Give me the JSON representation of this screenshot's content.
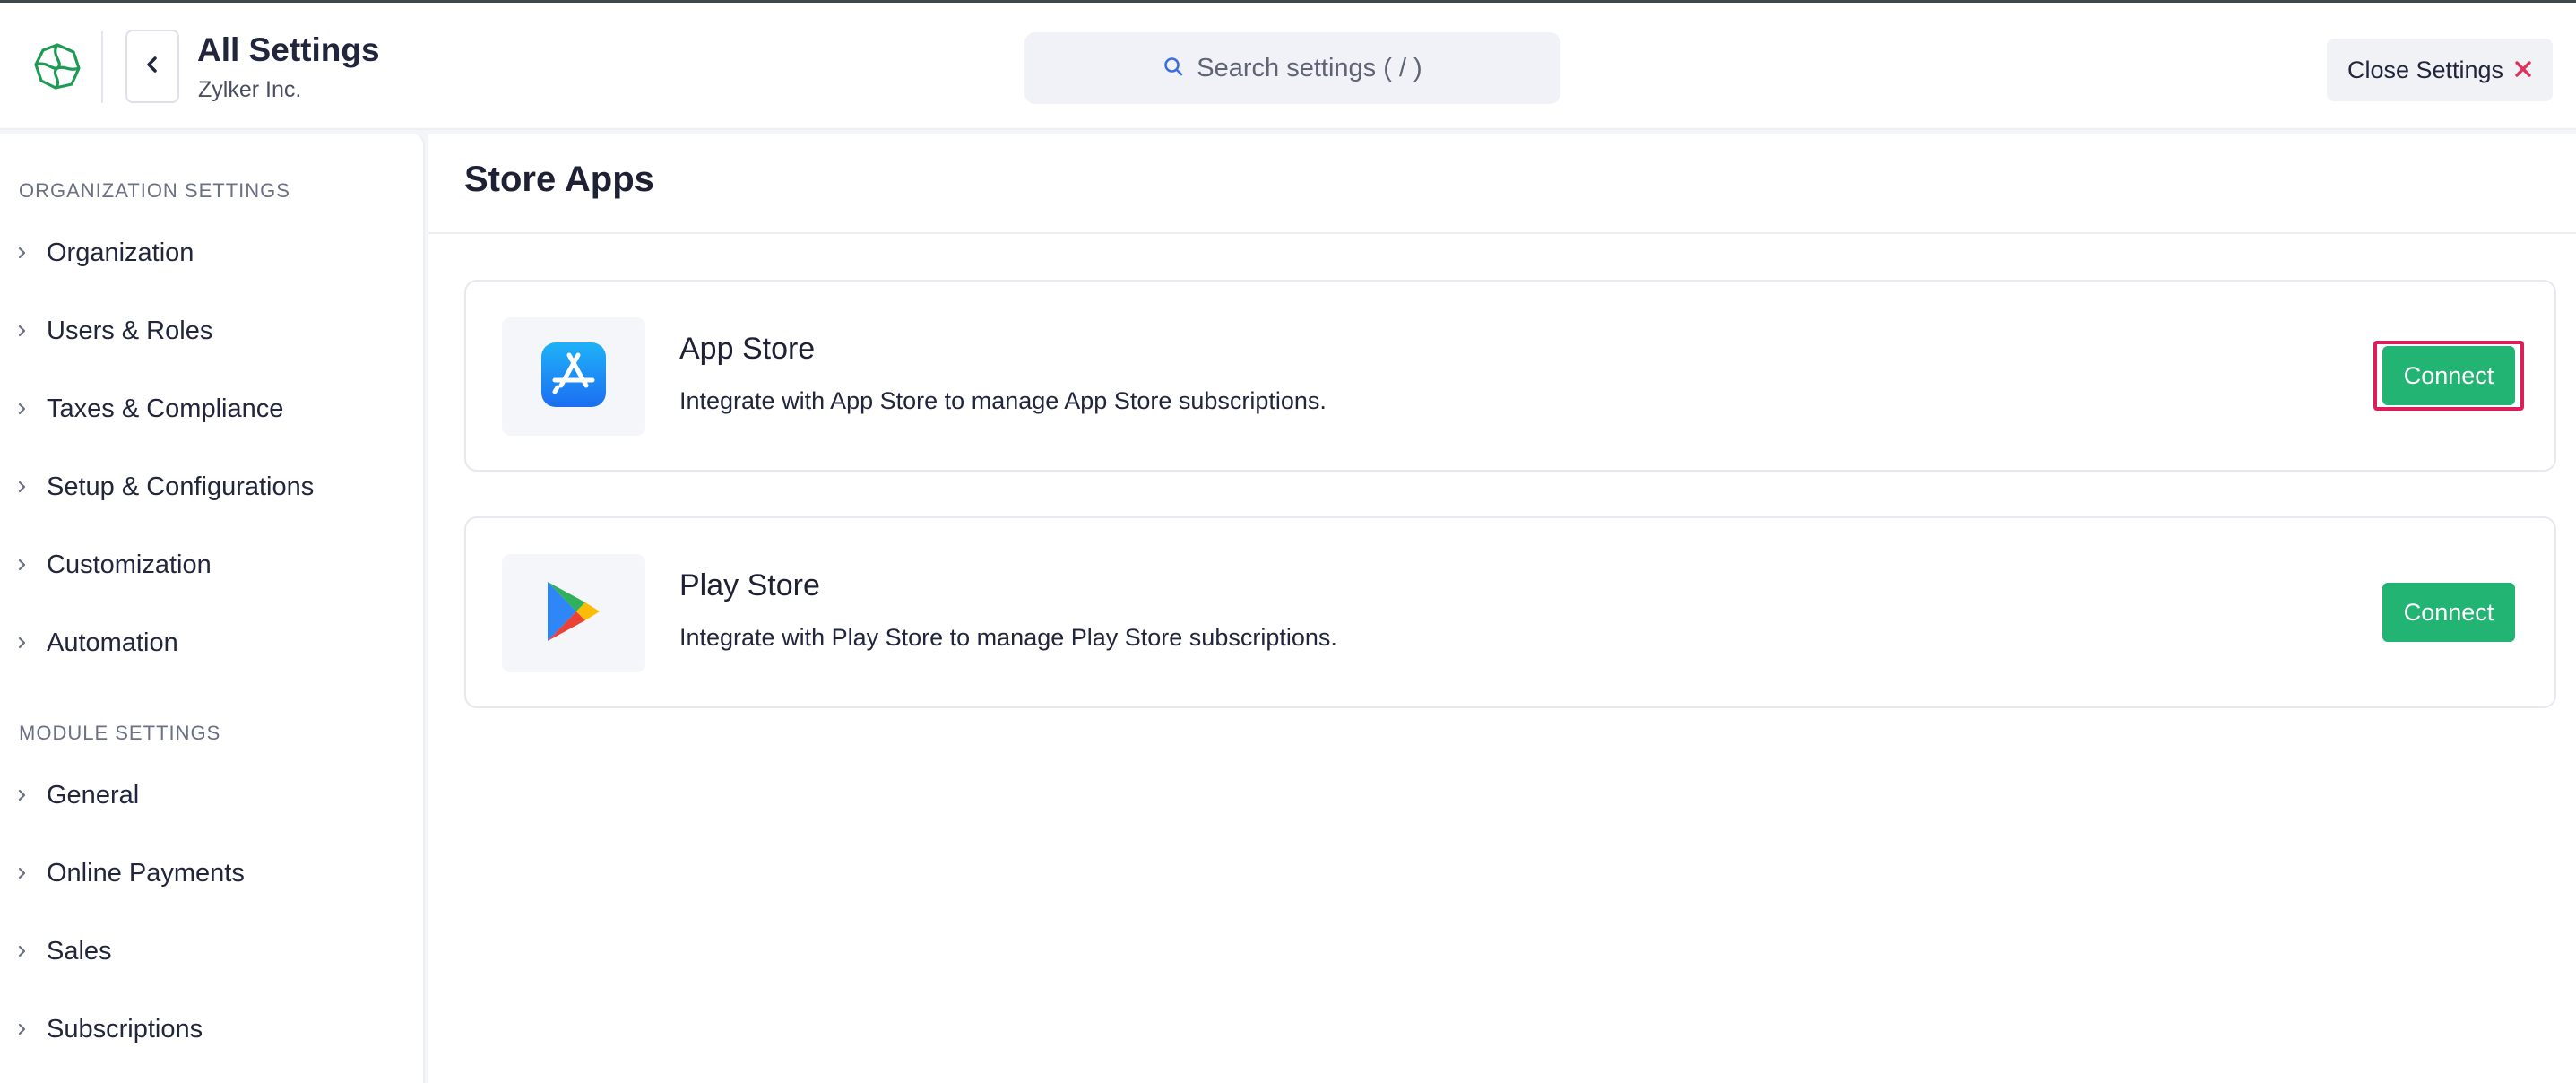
{
  "header": {
    "title": "All Settings",
    "organization": "Zylker Inc.",
    "logo_icon": "zoho-billing-logo-icon",
    "back_icon": "chevron-left-icon",
    "search": {
      "placeholder": "Search settings ( / )",
      "icon": "search-icon"
    },
    "close_label": "Close Settings",
    "close_icon": "close-icon"
  },
  "sidebar": {
    "org_section_title": "ORGANIZATION SETTINGS",
    "org_items": [
      {
        "label": "Organization"
      },
      {
        "label": "Users & Roles"
      },
      {
        "label": "Taxes & Compliance"
      },
      {
        "label": "Setup & Configurations"
      },
      {
        "label": "Customization"
      },
      {
        "label": "Automation"
      }
    ],
    "module_section_title": "MODULE SETTINGS",
    "module_items": [
      {
        "label": "General"
      },
      {
        "label": "Online Payments"
      },
      {
        "label": "Sales"
      },
      {
        "label": "Subscriptions"
      }
    ]
  },
  "main": {
    "title": "Store Apps",
    "apps": [
      {
        "name": "App Store",
        "description": "Integrate with App Store to manage App Store subscriptions.",
        "button_label": "Connect",
        "icon": "app-store-icon",
        "highlighted": true
      },
      {
        "name": "Play Store",
        "description": "Integrate with Play Store to manage Play Store subscriptions.",
        "button_label": "Connect",
        "icon": "play-store-icon",
        "highlighted": false
      }
    ]
  },
  "colors": {
    "accent_green": "#22b473",
    "highlight_red": "#dd1e58",
    "close_x_red": "#e0315b"
  }
}
